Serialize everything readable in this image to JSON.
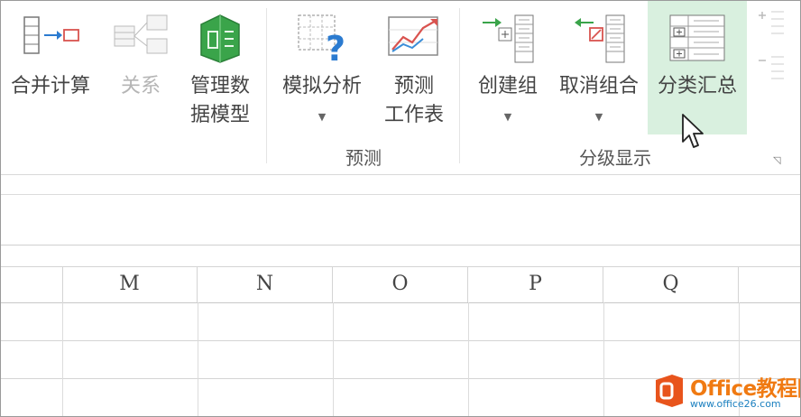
{
  "ribbon": {
    "buttons": {
      "consolidate": "合并计算",
      "relationships": "关系",
      "data_model_l1": "管理数",
      "data_model_l2": "据模型",
      "what_if": "模拟分析",
      "forecast_l1": "预测",
      "forecast_l2": "工作表",
      "group": "创建组",
      "ungroup": "取消组合",
      "subtotal": "分类汇总"
    },
    "groups": {
      "forecast": "预测",
      "outline": "分级显示"
    }
  },
  "sheet": {
    "columns": [
      "M",
      "N",
      "O",
      "P",
      "Q"
    ]
  },
  "watermark": {
    "brand": "Office教程网",
    "url": "www.office26.com"
  },
  "colors": {
    "hover": "#d9f0df",
    "accent_green": "#3aa44a",
    "arrow_red": "#d9534f",
    "brand_orange": "#f07a12"
  }
}
